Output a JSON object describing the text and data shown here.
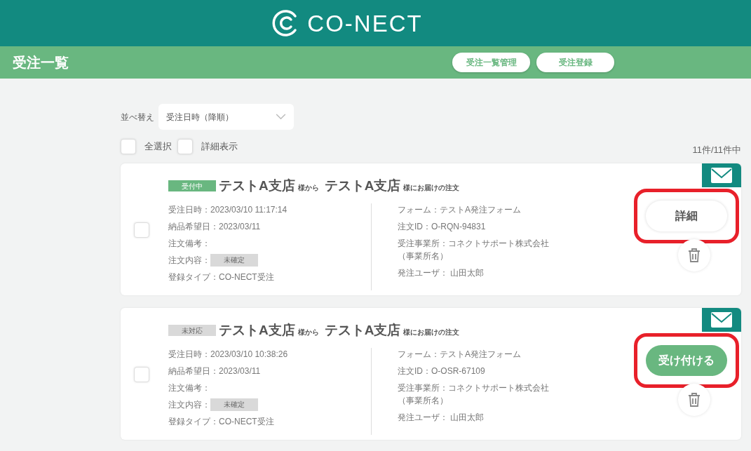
{
  "header": {
    "logo_text": "CO-NECT"
  },
  "page_bar": {
    "title": "受注一覧",
    "buttons": [
      "受注一覧管理",
      "受注登録"
    ]
  },
  "controls": {
    "sort_label": "並べ替え",
    "sort_value": "受注日時（降順）",
    "checkboxes": [
      {
        "label": "全選択",
        "checked": false
      },
      {
        "label": "詳細表示",
        "checked": false
      }
    ],
    "count": "11件/11件中"
  },
  "orders": [
    {
      "checked": false,
      "status": {
        "kind": "accepted",
        "label": "受付中"
      },
      "from": "テストA支店",
      "from_suffix": "様から",
      "to": "テストA支店",
      "to_suffix": "様にお届けの注文",
      "left": [
        {
          "text": "受注日時：2023/03/10 11:17:14"
        },
        {
          "text": "納品希望日：2023/03/11"
        },
        {
          "text": "注文備考："
        },
        {
          "text": "注文内容：",
          "chip": "未確定"
        },
        {
          "text": "登録タイプ：CO-NECT受注"
        }
      ],
      "right": [
        [
          "フォーム：テストA発注フォーム"
        ],
        [
          "注文ID：O-RQN-94831"
        ],
        [
          "受注事業所：コネクトサポート株式会社",
          "（事業所名）"
        ],
        [
          "発注ユーザ： 山田太郎"
        ]
      ],
      "action": {
        "kind": "detail",
        "label": "詳細",
        "highlighted": true
      }
    },
    {
      "checked": false,
      "status": {
        "kind": "pending",
        "label": "未対応"
      },
      "from": "テストA支店",
      "from_suffix": "様から",
      "to": "テストA支店",
      "to_suffix": "様にお届けの注文",
      "left": [
        {
          "text": "受注日時：2023/03/10 10:38:26"
        },
        {
          "text": "納品希望日：2023/03/11"
        },
        {
          "text": "注文備考："
        },
        {
          "text": "注文内容：",
          "chip": "未確定"
        },
        {
          "text": "登録タイプ：CO-NECT受注"
        }
      ],
      "right": [
        [
          "フォーム：テストA発注フォーム"
        ],
        [
          "注文ID：O-OSR-67109"
        ],
        [
          "受注事業所：コネクトサポート株式会社",
          "（事業所名）"
        ],
        [
          "発注ユーザ： 山田太郎"
        ]
      ],
      "action": {
        "kind": "accept",
        "label": "受け付ける",
        "highlighted": true
      }
    }
  ]
}
